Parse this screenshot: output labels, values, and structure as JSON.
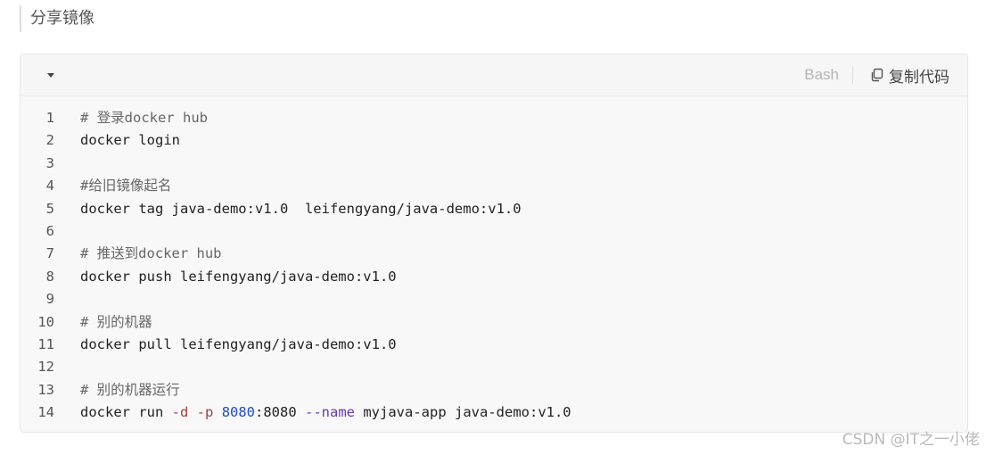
{
  "section_heading": "分享镜像",
  "toolbar": {
    "language": "Bash",
    "copy_label": "复制代码",
    "copy_icon": "copy-icon",
    "collapse_icon": "caret-down-icon"
  },
  "code_lines": [
    {
      "number": "1",
      "text": "# 登录docker hub"
    },
    {
      "number": "2",
      "text": "docker login"
    },
    {
      "number": "3",
      "text": ""
    },
    {
      "number": "4",
      "text": "#给旧镜像起名"
    },
    {
      "number": "5",
      "text": "docker tag java-demo:v1.0  leifengyang/java-demo:v1.0"
    },
    {
      "number": "6",
      "text": ""
    },
    {
      "number": "7",
      "text": "# 推送到docker hub"
    },
    {
      "number": "8",
      "text": "docker push leifengyang/java-demo:v1.0"
    },
    {
      "number": "9",
      "text": ""
    },
    {
      "number": "10",
      "text": "# 别的机器"
    },
    {
      "number": "11",
      "text": "docker pull leifengyang/java-demo:v1.0"
    },
    {
      "number": "12",
      "text": ""
    },
    {
      "number": "13",
      "text": "# 别的机器运行"
    },
    {
      "number": "14",
      "parts": {
        "cmd": "docker run ",
        "flag_d": "-d",
        "space1": " ",
        "flag_p": "-p",
        "space2": " ",
        "port_num": "8080",
        "port_rest": ":8080 ",
        "flag_name": "--name",
        "rest": " myjava-app java-demo:v1.0"
      }
    }
  ],
  "watermark": "CSDN @IT之一小佬",
  "colors": {
    "comment": "#666666",
    "flag": "#a04141",
    "number": "#1e4dc0",
    "long_flag": "#6a35a8"
  }
}
